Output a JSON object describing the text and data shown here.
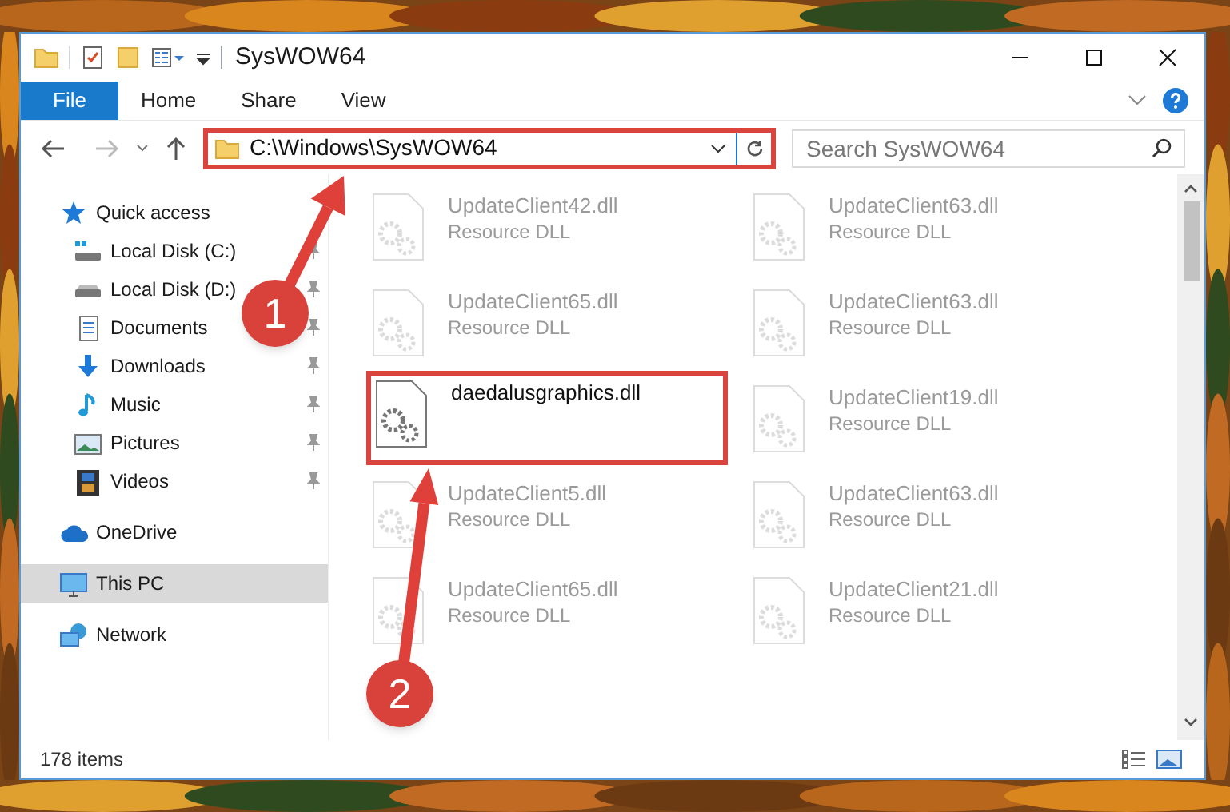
{
  "window": {
    "title": "SysWOW64"
  },
  "ribbon_tabs": [
    {
      "label": "File",
      "selected": true
    },
    {
      "label": "Home",
      "selected": false
    },
    {
      "label": "Share",
      "selected": false
    },
    {
      "label": "View",
      "selected": false
    }
  ],
  "address_bar": {
    "path": "C:\\Windows\\SysWOW64",
    "highlighted": true
  },
  "search": {
    "placeholder": "Search SysWOW64"
  },
  "sidebar": {
    "items": [
      {
        "label": "Quick access",
        "kind": "star",
        "selected": false,
        "children": [
          {
            "label": "Local Disk (C:)",
            "kind": "system-drive",
            "pinned": true,
            "selected": false
          },
          {
            "label": "Local Disk (D:)",
            "kind": "drive",
            "pinned": true,
            "selected": false
          },
          {
            "label": "Documents",
            "kind": "documents",
            "pinned": true,
            "selected": false
          },
          {
            "label": "Downloads",
            "kind": "downloads",
            "pinned": true,
            "selected": false
          },
          {
            "label": "Music",
            "kind": "music",
            "pinned": true,
            "selected": false
          },
          {
            "label": "Pictures",
            "kind": "pictures",
            "pinned": true,
            "selected": false
          },
          {
            "label": "Videos",
            "kind": "videos",
            "pinned": true,
            "selected": false
          }
        ]
      },
      {
        "label": "OneDrive",
        "kind": "cloud",
        "selected": false
      },
      {
        "label": "This PC",
        "kind": "pc",
        "selected": true
      },
      {
        "label": "Network",
        "kind": "network",
        "selected": false
      }
    ]
  },
  "files": [
    {
      "name": "UpdateClient42.dll",
      "type": "Resource DLL",
      "highlighted": false
    },
    {
      "name": "UpdateClient63.dll",
      "type": "Resource DLL",
      "highlighted": false
    },
    {
      "name": "UpdateClient65.dll",
      "type": "Resource DLL",
      "highlighted": false
    },
    {
      "name": "UpdateClient63.dll",
      "type": "Resource DLL",
      "highlighted": false
    },
    {
      "name": "daedalusgraphics.dll",
      "highlighted": true
    },
    {
      "name": "UpdateClient19.dll",
      "type": "Resource DLL",
      "highlighted": false
    },
    {
      "name": "UpdateClient5.dll",
      "type": "Resource DLL",
      "highlighted": false
    },
    {
      "name": "UpdateClient63.dll",
      "type": "Resource DLL",
      "highlighted": false
    },
    {
      "name": "UpdateClient65.dll",
      "type": "Resource DLL",
      "highlighted": false
    },
    {
      "name": "UpdateClient21.dll",
      "type": "Resource DLL",
      "highlighted": false
    }
  ],
  "status_bar": {
    "item_count": "178 items"
  },
  "callouts": [
    {
      "number": "1"
    },
    {
      "number": "2"
    }
  ]
}
